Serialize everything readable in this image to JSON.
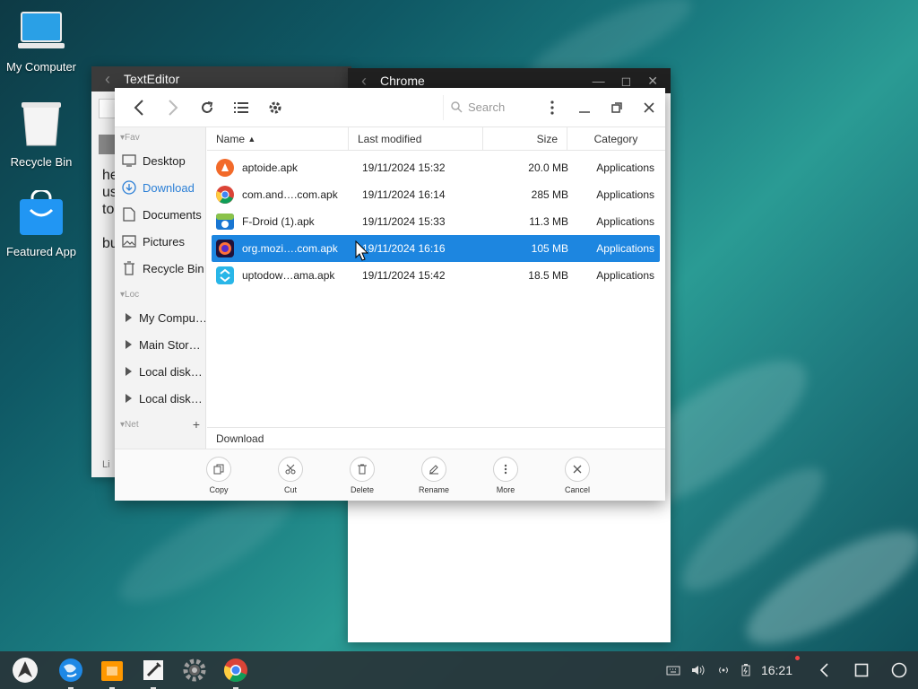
{
  "desktop": {
    "icons": [
      {
        "label": "My Computer",
        "icon": "laptop-icon"
      },
      {
        "label": "Recycle Bin",
        "icon": "recycle-bin-icon"
      },
      {
        "label": "Featured App",
        "icon": "shopping-bag-icon"
      }
    ]
  },
  "texteditor": {
    "title": "TextEditor",
    "lines": [
      "he",
      "us",
      "to",
      "",
      "bu"
    ],
    "footer": "Li"
  },
  "chrome": {
    "title": "Chrome"
  },
  "file_manager": {
    "search_placeholder": "Search",
    "sidebar": {
      "fav_label": "Fav",
      "fav_items": [
        {
          "label": "Desktop",
          "icon": "desktop-icon"
        },
        {
          "label": "Download",
          "icon": "download-icon",
          "active": true
        },
        {
          "label": "Documents",
          "icon": "document-icon"
        },
        {
          "label": "Pictures",
          "icon": "picture-icon"
        },
        {
          "label": "Recycle Bin",
          "icon": "trash-icon"
        }
      ],
      "loc_label": "Loc",
      "loc_items": [
        {
          "label": "My Compu…"
        },
        {
          "label": "Main Stor…"
        },
        {
          "label": "Local disk…"
        },
        {
          "label": "Local disk…"
        }
      ],
      "net_label": "Net"
    },
    "columns": {
      "name": "Name",
      "modified": "Last modified",
      "size": "Size",
      "category": "Category"
    },
    "files": [
      {
        "name": "aptoide.apk",
        "modified": "19/11/2024 15:32",
        "size": "20.0 MB",
        "category": "Applications",
        "icon": "aptoide-icon",
        "selected": false
      },
      {
        "name": "com.and….com.apk",
        "modified": "19/11/2024 16:14",
        "size": "285 MB",
        "category": "Applications",
        "icon": "chrome-icon",
        "selected": false
      },
      {
        "name": "F-Droid (1).apk",
        "modified": "19/11/2024 15:33",
        "size": "11.3 MB",
        "category": "Applications",
        "icon": "fdroid-icon",
        "selected": false
      },
      {
        "name": "org.mozi….com.apk",
        "modified": "19/11/2024 16:16",
        "size": "105 MB",
        "category": "Applications",
        "icon": "firefox-icon",
        "selected": true
      },
      {
        "name": "uptodow…ama.apk",
        "modified": "19/11/2024 15:42",
        "size": "18.5 MB",
        "category": "Applications",
        "icon": "uptodown-icon",
        "selected": false
      }
    ],
    "path": "Download",
    "actions": [
      {
        "label": "Copy",
        "icon": "copy-icon"
      },
      {
        "label": "Cut",
        "icon": "scissors-icon"
      },
      {
        "label": "Delete",
        "icon": "trash-icon"
      },
      {
        "label": "Rename",
        "icon": "pencil-icon"
      },
      {
        "label": "More",
        "icon": "more-vertical-icon"
      },
      {
        "label": "Cancel",
        "icon": "close-icon"
      }
    ]
  },
  "taskbar": {
    "clock": "16:21"
  },
  "colors": {
    "selection": "#1d86e0",
    "active_sidebar": "#2b7fd6"
  }
}
